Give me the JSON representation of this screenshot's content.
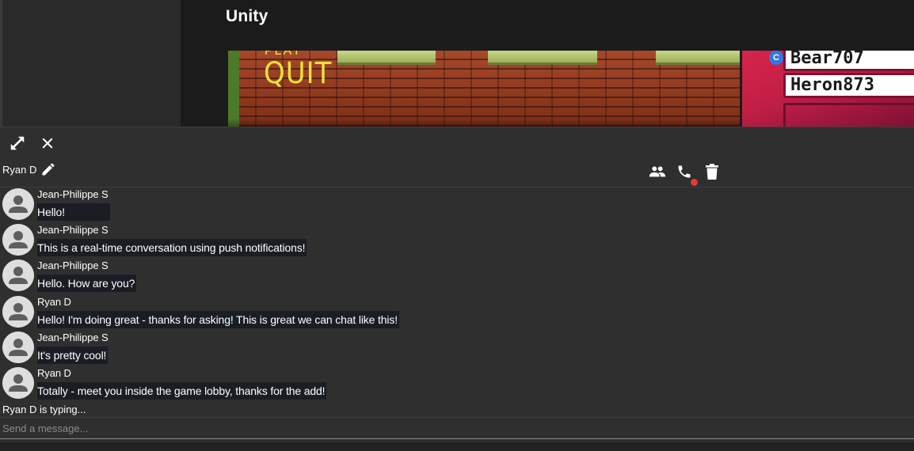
{
  "app": {
    "title": "Unity"
  },
  "game_preview": {
    "menu_top_label": "PLAY",
    "menu_quit_label": "QUIT",
    "leaderboard": {
      "badge": "C",
      "players": [
        "Bear707",
        "Heron873"
      ]
    }
  },
  "chat": {
    "title": "Ryan D",
    "icons": {
      "expand": "expand-icon",
      "close": "close-icon",
      "edit": "pencil-icon",
      "members": "people-icon",
      "call": "phone-icon",
      "delete": "trash-icon"
    },
    "messages": [
      {
        "sender": "Jean-Philippe S",
        "text": "Hello!"
      },
      {
        "sender": "Jean-Philippe S",
        "text": "This is a real-time conversation using push notifications!"
      },
      {
        "sender": "Jean-Philippe S",
        "text": "Hello. How are you?"
      },
      {
        "sender": "Ryan D",
        "text": "Hello! I'm doing great - thanks for asking! This is great we can chat like this!"
      },
      {
        "sender": "Jean-Philippe S",
        "text": "It's pretty cool!"
      },
      {
        "sender": "Ryan D",
        "text": "Totally - meet you inside the game lobby, thanks for the add!"
      }
    ],
    "typing_indicator": "Ryan D is typing...",
    "input": {
      "placeholder": "Send a message...",
      "value": ""
    }
  },
  "colors": {
    "background": "#1e1e1e",
    "chat_panel": "#2f2f2f",
    "message_highlight": "#1a1d24",
    "call_status_dot": "#e53935",
    "leaderboard_accent": "#d5244b"
  }
}
